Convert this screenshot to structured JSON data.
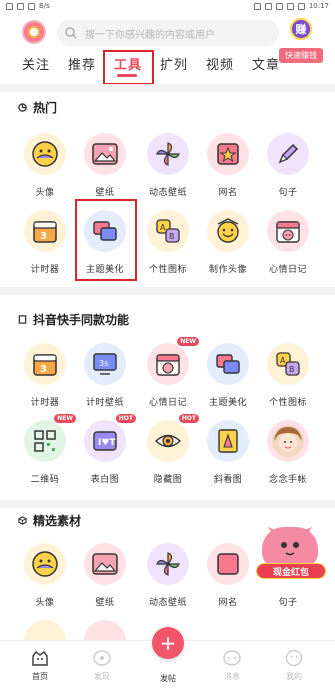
{
  "status": {
    "network": "B/s",
    "time": "10:17"
  },
  "search": {
    "placeholder": "搜一下你感兴趣的内容或用户"
  },
  "earn": {
    "badge": "赚",
    "label": "快速赚钱"
  },
  "tabs": [
    "关注",
    "推荐",
    "工具",
    "扩列",
    "视频",
    "文章"
  ],
  "active_tab": "工具",
  "sections": {
    "hot": {
      "title": "热门"
    },
    "douyin": {
      "title": "抖音快手同款功能"
    },
    "select": {
      "title": "精选素材"
    }
  },
  "hot_row1": [
    "头像",
    "壁纸",
    "动态壁纸",
    "网名",
    "句子"
  ],
  "hot_row2": [
    "计时器",
    "主题美化",
    "个性图标",
    "制作头像",
    "心情日记"
  ],
  "douyin_row1": [
    "计时器",
    "计时壁纸",
    "心情日记",
    "主题美化",
    "个性图标"
  ],
  "douyin_row2": [
    "二维码",
    "表白图",
    "隐藏图",
    "斜看图",
    "念念手帐"
  ],
  "select_row1": [
    "头像",
    "壁纸",
    "动态壁纸",
    "网名",
    "句子"
  ],
  "badges": {
    "new": "NEW",
    "hot": "HOT"
  },
  "redpacket": {
    "label": "现金红包"
  },
  "bottom_nav": {
    "home": "首页",
    "discover": "发现",
    "post": "发帖",
    "message": "消息",
    "mine": "我的"
  },
  "colors": {
    "accent": "#e54b5c",
    "highlight_box": "#d8262b"
  }
}
